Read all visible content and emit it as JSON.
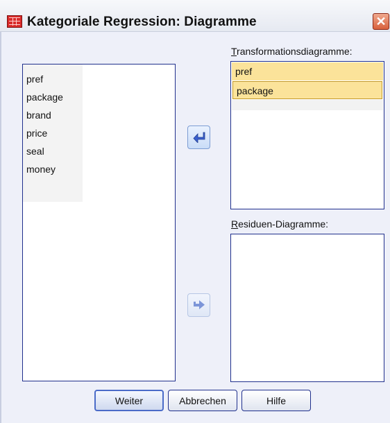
{
  "window": {
    "title": "Kategoriale Regression: Diagramme",
    "close_glyph": "✕"
  },
  "source_list": {
    "items": [
      "pref",
      "package",
      "brand",
      "price",
      "seal",
      "money"
    ]
  },
  "transform_list": {
    "label_first": "T",
    "label_rest": "ransformationsdiagramme:",
    "items": [
      "pref",
      "package"
    ],
    "selected_index": 1
  },
  "residual_list": {
    "label_first": "R",
    "label_rest": "esiduen-Diagramme:",
    "items": []
  },
  "buttons": {
    "continue": "Weiter",
    "cancel": "Abbrechen",
    "help": "Hilfe"
  },
  "icons": {
    "move_to_source": "arrow-left-icon",
    "move_to_residual": "arrow-right-icon",
    "app": "spss-table-icon",
    "close": "close-icon"
  },
  "colors": {
    "selection": "#fbe39a",
    "list_border": "#1f2f8c",
    "dialog_bg": "#eef0f9"
  }
}
